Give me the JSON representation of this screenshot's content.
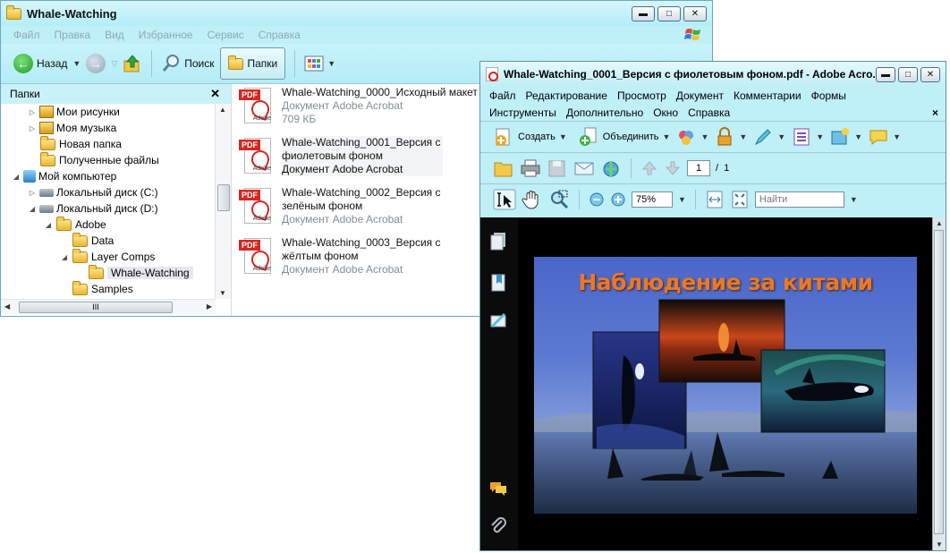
{
  "explorer": {
    "title": "Whale-Watching",
    "menu": [
      "Файл",
      "Правка",
      "Вид",
      "Избранное",
      "Сервис",
      "Справка"
    ],
    "toolbar": {
      "back": "Назад",
      "search": "Поиск",
      "folders": "Папки"
    },
    "folders_pane": {
      "title": "Папки",
      "close": "✕",
      "tree": [
        {
          "label": "Мои рисунки",
          "indent": 1,
          "expander": "▷",
          "icon": "pictures-folder-icon"
        },
        {
          "label": "Моя музыка",
          "indent": 1,
          "expander": "▷",
          "icon": "music-folder-icon"
        },
        {
          "label": "Новая папка",
          "indent": 1,
          "expander": "",
          "icon": "folder-icon"
        },
        {
          "label": "Полученные файлы",
          "indent": 1,
          "expander": "",
          "icon": "folder-icon"
        },
        {
          "label": "Мой компьютер",
          "indent": 0,
          "expander": "◢",
          "icon": "computer-icon"
        },
        {
          "label": "Локальный диск (C:)",
          "indent": 1,
          "expander": "▷",
          "icon": "drive-icon"
        },
        {
          "label": "Локальный диск (D:)",
          "indent": 1,
          "expander": "◢",
          "icon": "drive-icon"
        },
        {
          "label": "Adobe",
          "indent": 2,
          "expander": "◢",
          "icon": "folder-icon"
        },
        {
          "label": "Data",
          "indent": 3,
          "expander": "",
          "icon": "folder-icon"
        },
        {
          "label": "Layer Comps",
          "indent": 3,
          "expander": "◢",
          "icon": "folder-icon"
        },
        {
          "label": "Whale-Watching",
          "indent": 4,
          "expander": "",
          "icon": "folder-icon",
          "selected": true
        },
        {
          "label": "Samples",
          "indent": 3,
          "expander": "",
          "icon": "folder-icon"
        }
      ]
    },
    "files": [
      {
        "name": "Whale-Watching_0000_Исходный макет",
        "type": "Документ Adobe Acrobat",
        "size": "709 КБ"
      },
      {
        "name": "Whale-Watching_0001_Версия с фиолетовым фоном",
        "type": "Документ Adobe Acrobat",
        "selected": true
      },
      {
        "name": "Whale-Watching_0002_Версия с зелёным фоном",
        "type": "Документ Adobe Acrobat"
      },
      {
        "name": "Whale-Watching_0003_Версия с жёлтым фоном",
        "type": "Документ Adobe Acrobat"
      }
    ],
    "pdf_tag": "PDF",
    "adobe_tag": "Adobe"
  },
  "acrobat": {
    "title": "Whale-Watching_0001_Версия с фиолетовым фоном.pdf - Adobe Acro...",
    "menu_row1": [
      "Файл",
      "Редактирование",
      "Просмотр",
      "Документ",
      "Комментарии",
      "Формы"
    ],
    "menu_row2": [
      "Инструменты",
      "Дополнительно",
      "Окно",
      "Справка"
    ],
    "menu_close": "×",
    "toolbar": {
      "create": "Создать",
      "combine": "Объединить"
    },
    "page": {
      "current": "1",
      "separator": "/",
      "total": "1"
    },
    "zoom": "75%",
    "find_placeholder": "Найти",
    "slide_title": "Наблюдение за китами"
  },
  "colors": {
    "explorer_chrome": "#bff0f8",
    "acrobat_chrome": "#bfeff7",
    "slide_title": "#e8792a",
    "pdf_red": "#d7261f"
  }
}
